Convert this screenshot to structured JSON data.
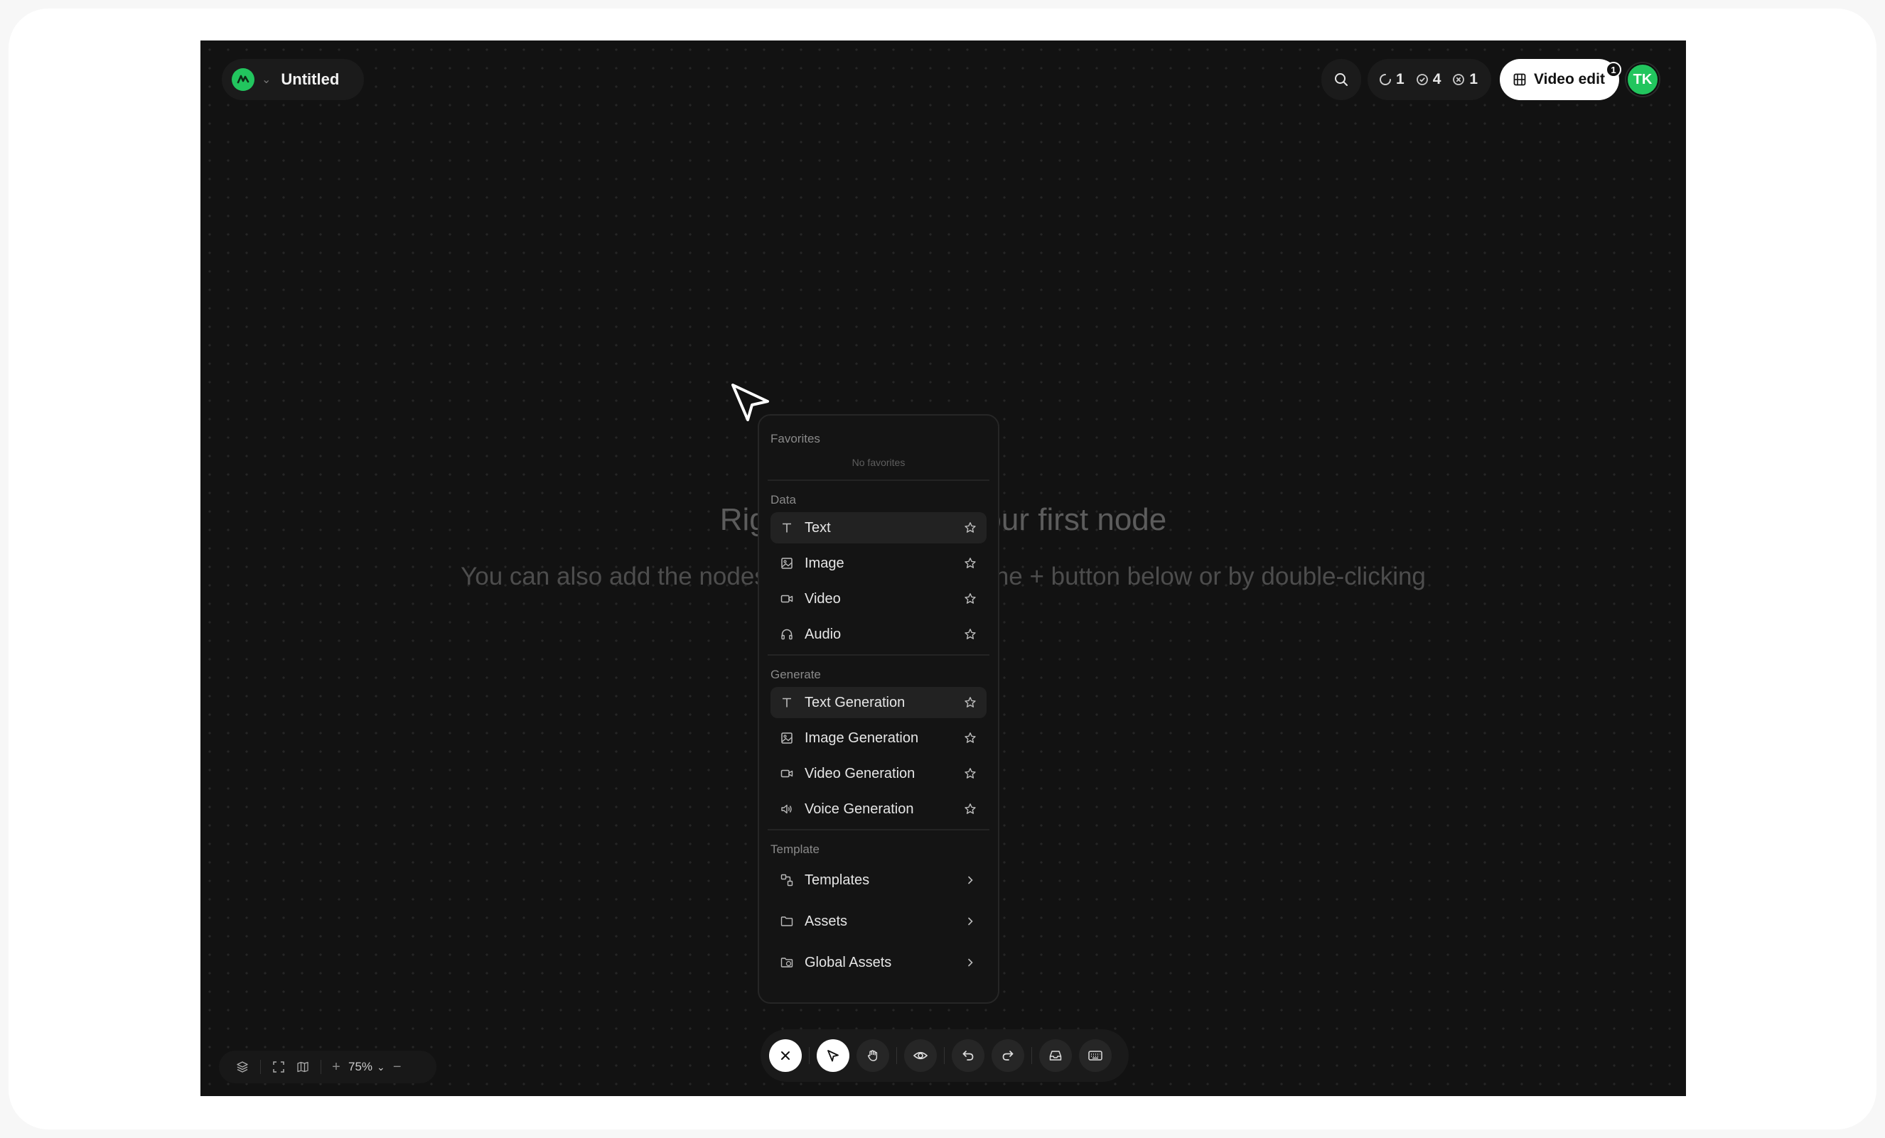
{
  "header": {
    "title": "Untitled",
    "counts": {
      "running": "1",
      "completed": "4",
      "failed": "1"
    },
    "video_edit_label": "Video edit",
    "video_edit_badge": "1",
    "avatar_initials": "TK"
  },
  "canvas": {
    "hint_title": "Right-click to add your first node",
    "hint_subtitle": "You can also add the nodes and templates with the + button below or by double-clicking"
  },
  "menu": {
    "favorites_label": "Favorites",
    "no_favorites": "No favorites",
    "data_label": "Data",
    "data_items": [
      "Text",
      "Image",
      "Video",
      "Audio"
    ],
    "generate_label": "Generate",
    "generate_items": [
      "Text Generation",
      "Image Generation",
      "Video Generation",
      "Voice Generation"
    ],
    "template_label": "Template",
    "template_items": [
      "Templates",
      "Assets",
      "Global Assets"
    ]
  },
  "zoom": {
    "level": "75%"
  },
  "colors": {
    "accent": "#22c55e",
    "canvas": "#121212",
    "menu": "#141414"
  }
}
